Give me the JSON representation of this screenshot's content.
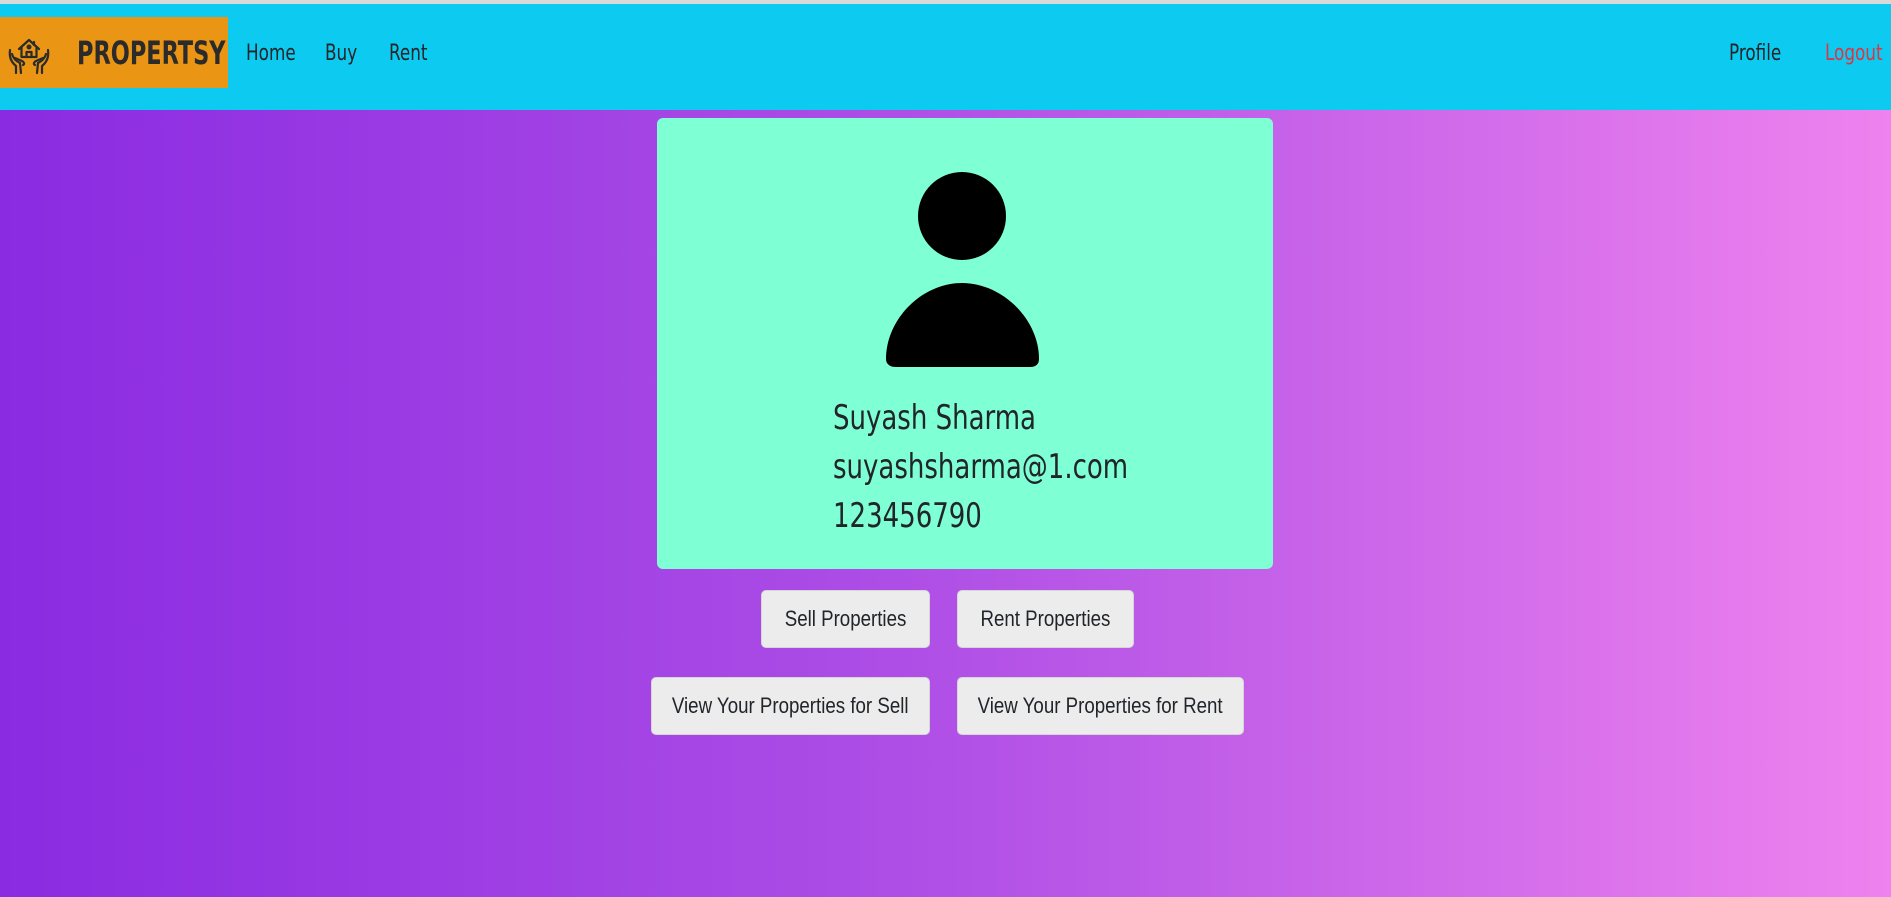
{
  "navbar": {
    "brand_name": "PROPERTSY",
    "logo_icon": "house-in-hands-icon",
    "links": {
      "home": "Home",
      "buy": "Buy",
      "rent": "Rent",
      "profile": "Profile",
      "logout": "Logout"
    },
    "colors": {
      "navbar_bg": "#0dcaf0",
      "brand_bg": "#ea9514",
      "logout": "#dc3545"
    }
  },
  "profile_card": {
    "avatar_icon": "user-avatar-icon",
    "name": "Suyash Sharma",
    "email": "suyashsharma@1.com",
    "phone": "123456790",
    "bg_color": "#7fffd4"
  },
  "actions": {
    "sell_properties": "Sell Properties",
    "rent_properties": "Rent Properties",
    "view_sell": "View Your Properties for Sell",
    "view_rent": "View Your Properties for Rent"
  },
  "page": {
    "background_gradient": [
      "#8a2be2",
      "#ee82ee"
    ]
  }
}
